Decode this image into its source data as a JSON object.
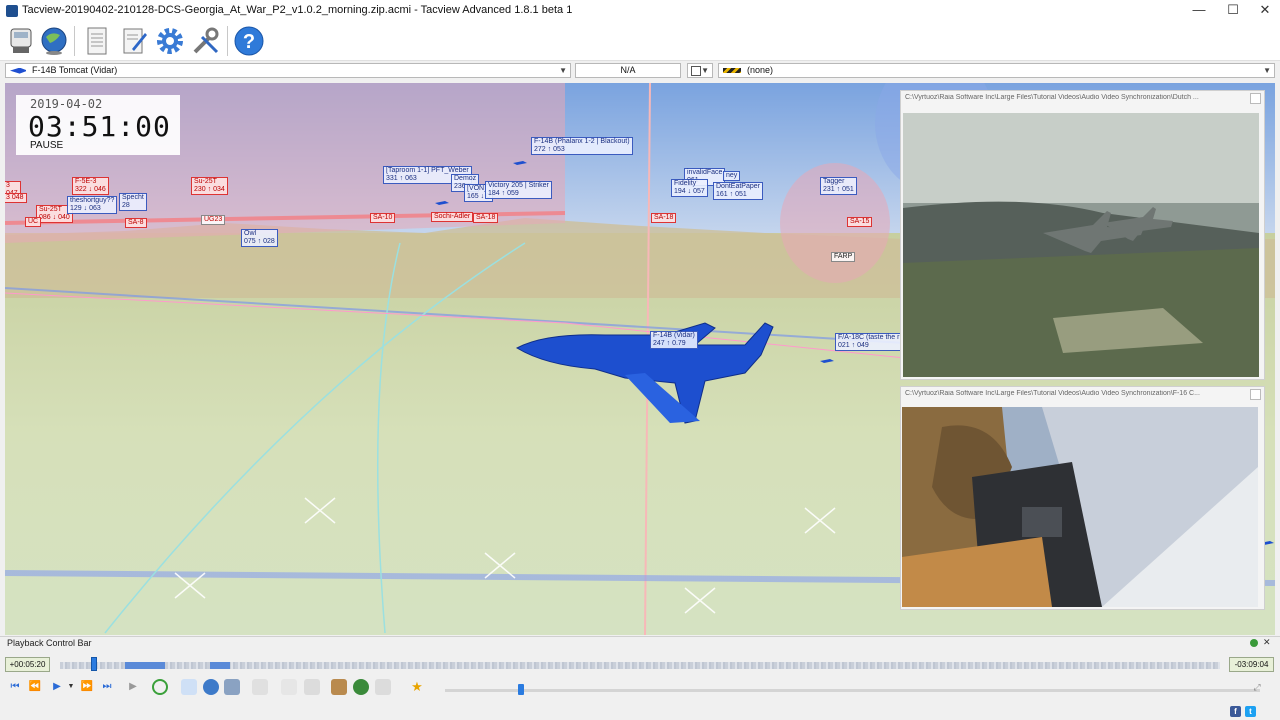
{
  "window": {
    "title": "Tacview-20190402-210128-DCS-Georgia_At_War_P2_v1.0.2_morning.zip.acmi - Tacview Advanced 1.8.1 beta 1",
    "minimize": "—",
    "maximize": "☐",
    "close": "✕"
  },
  "toolbar": {
    "icons": [
      "recorder-icon",
      "globe-icon",
      "document-icon",
      "notepad-icon",
      "settings-icon",
      "tools-icon",
      "help-icon"
    ]
  },
  "selection": {
    "primary_object": "F-14B Tomcat (Vidar)",
    "secondary_value": "N/A",
    "target_object": "(none)"
  },
  "clock": {
    "date": "2019-04-02",
    "time": "03:51:00",
    "state": "PAUSE"
  },
  "labels": {
    "phalanx": "F-14B (Phalanx 1-2 | Blackout)",
    "phalanx_data": "272 ↑ 053",
    "taproom": "[Taproom 1-1] PFT_Weber",
    "taproom_data": "331 ↑ 063",
    "demoz": "Demoz",
    "demoz_id": "236",
    "von": "[VON]",
    "von_data": "165 ↓ 0",
    "victory": "Victory 205 | Striker",
    "victory_data": "184 ↑ 059",
    "invalidface": "invalidFace",
    "invalidface_data": "061",
    "honey": "ney",
    "fidelity": "Fidelity",
    "fidelity_data": "194 ↓ 057",
    "donteat": "DontEatPaper",
    "donteat_data": "161 ↑ 051",
    "tagger": "Tagger",
    "tagger_data": "231 ↑ 051",
    "f5e3": "F-5E-3",
    "f5e3_data": "322 ↓ 046",
    "su25t_a": "Su-25T",
    "su25t_a_data": "230 ↑ 034",
    "su25t_b": "Su-25T",
    "su25t_b_data": "086 ↓ 040",
    "shortguy": "theshortguy??",
    "shortguy_data": "129 ↓ 063",
    "specht": "Specht",
    "specht_data": "28",
    "owl": "Owl",
    "owl_data": "075 ↑ 028",
    "sa8": "SA-8",
    "ug23": "UG23",
    "sa10": "SA-10",
    "sochi": "Sochi-Adler",
    "sa18_a": "SA-18",
    "sa18_b": "SA-18",
    "sa15": "SA-15",
    "farp": "FARP",
    "vidar": "F-14B (Vidar)",
    "vidar_data": "247 ↑ 0.79",
    "fa18c": "F/A-18C (taste the r",
    "fa18c_data": "021 ↑ 049",
    "left_a": "3",
    "left_b": "047",
    "left_c": "3 048",
    "left_d": "UC"
  },
  "videos": {
    "top_path": "C:\\Vyrtuoz\\Raia Software Inc\\Large Files\\Tutorial Videos\\Audio Video Synchronization\\Dutch ...",
    "bottom_path": "C:\\Vyrtuoz\\Raia Software Inc\\Large Files\\Tutorial Videos\\Audio Video Synchronization\\F-16 C..."
  },
  "playback": {
    "title": "Playback Control Bar",
    "elapsed": "+00:05:20",
    "remaining": "-03:09:04",
    "position_fraction": 0.027,
    "speed_fraction": 0.09
  },
  "colors": {
    "friendly": "#1f4fd1",
    "hostile": "#dd2222",
    "accent": "#2a7be0"
  }
}
